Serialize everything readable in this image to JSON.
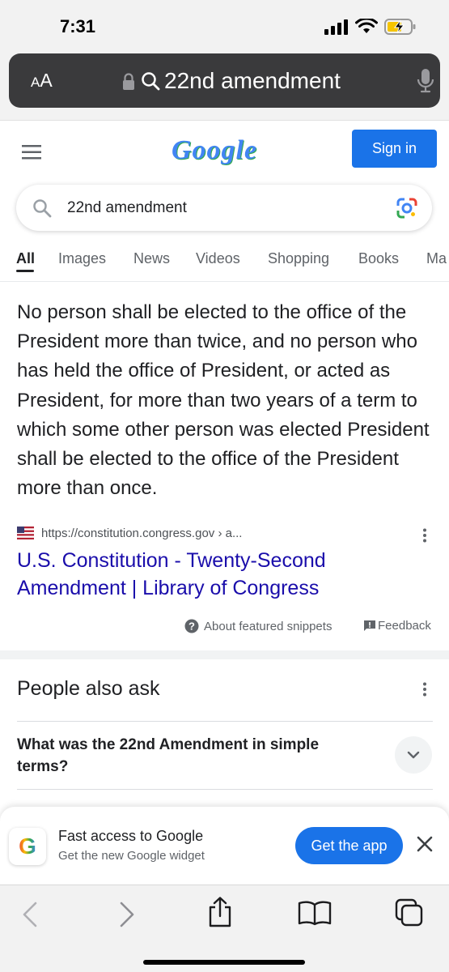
{
  "status_bar": {
    "time": "7:31",
    "icons": [
      "cellular-signal-icon",
      "wifi-icon",
      "battery-charging-icon"
    ]
  },
  "browser": {
    "text_size_label_small": "A",
    "text_size_label_large": "A",
    "url_field_text": "22nd amendment"
  },
  "google_header": {
    "logo_text": "Google",
    "sign_in_label": "Sign in"
  },
  "search": {
    "query": "22nd amendment"
  },
  "tabs": [
    {
      "label": "All",
      "active": true
    },
    {
      "label": "Images",
      "active": false
    },
    {
      "label": "News",
      "active": false
    },
    {
      "label": "Videos",
      "active": false
    },
    {
      "label": "Shopping",
      "active": false
    },
    {
      "label": "Books",
      "active": false
    },
    {
      "label": "Ma",
      "active": false
    }
  ],
  "featured_snippet": {
    "text": "No person shall be elected to the office of the President more than twice, and no person who has held the office of President, or acted as President, for more than two years of a term to which some other person was elected President shall be elected to the office of the President more than once.",
    "source_url": "https://constitution.congress.gov › a...",
    "link_title": "U.S. Constitution - Twenty-Second Amendment | Library of Congress",
    "about_label": "About featured snippets",
    "feedback_label": "Feedback"
  },
  "people_also_ask": {
    "title": "People also ask",
    "questions": [
      "What was the 22nd Amendment in simple terms?"
    ]
  },
  "app_promo": {
    "icon_letter": "G",
    "title": "Fast access to Google",
    "subtitle": "Get the new Google widget",
    "button_label": "Get the app"
  },
  "colors": {
    "google_blue": "#1a73e8",
    "link_color": "#1a0dab",
    "url_bar_bg": "#3a3a3c"
  }
}
